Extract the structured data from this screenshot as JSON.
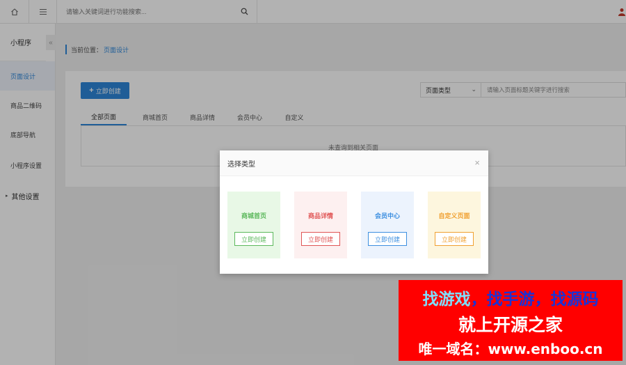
{
  "topbar": {
    "search_placeholder": "请输入关键词进行功能搜索..."
  },
  "sidebar": {
    "title": "小程序",
    "collapse_glyph": "«",
    "items": [
      {
        "label": "页面设计",
        "active": true
      },
      {
        "label": "商品二维码"
      },
      {
        "label": "底部导航"
      },
      {
        "label": "小程序设置"
      },
      {
        "label": "其他设置",
        "arrow": "▸"
      }
    ]
  },
  "breadcrumb": {
    "prefix": "当前位置：",
    "current": "页面设计"
  },
  "panel": {
    "create_button": "立即创建",
    "create_plus": "+",
    "type_select": "页面类型",
    "search_placeholder": "请输入页面标题关键字进行搜索",
    "tabs": [
      "全部页面",
      "商城首页",
      "商品详情",
      "会员中心",
      "自定义"
    ],
    "empty_text": "未查询到相关页面"
  },
  "modal": {
    "title": "选择类型",
    "close": "×",
    "cards": [
      {
        "title": "商城首页",
        "button": "立即创建",
        "color": "#5cb85c"
      },
      {
        "title": "商品详情",
        "button": "立即创建",
        "color": "#e05555"
      },
      {
        "title": "会员中心",
        "button": "立即创建",
        "color": "#3d8fe0"
      },
      {
        "title": "自定义页面",
        "button": "立即创建",
        "color": "#f0a030"
      }
    ]
  },
  "watermark": {
    "line1_a": "找游戏",
    "line1_b": "，找手游，找源码",
    "line2": "就上开源之家",
    "line3": "唯一域名：www.enboo.cn"
  }
}
